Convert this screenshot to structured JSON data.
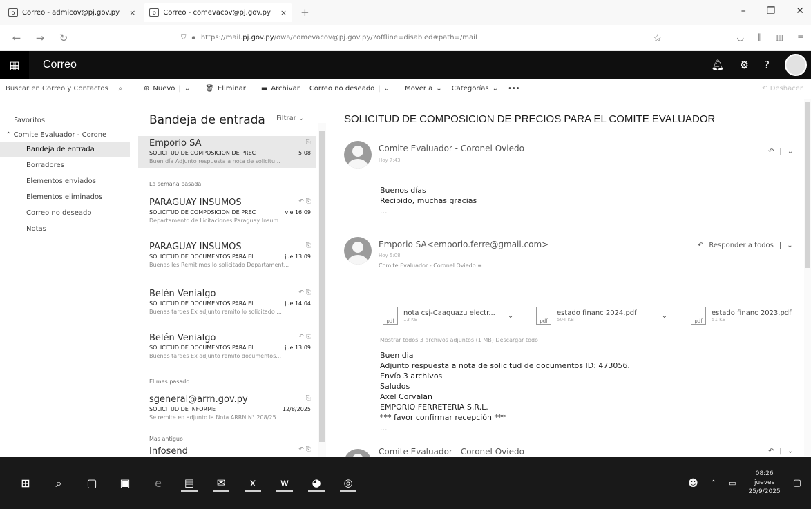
{
  "browser": {
    "tabs": [
      {
        "label": "Correo - admicov@pj.gov.py",
        "close": "×",
        "active": false
      },
      {
        "label": "Correo - comevacov@pj.gov.py",
        "close": "×",
        "active": true
      }
    ],
    "new_tab": "+",
    "url_prefix": "https://mail.",
    "url_domain": "pj.gov.py",
    "url_rest": "/owa/comevacov@pj.gov.py/?offline=disabled#path=/mail",
    "window_controls": [
      "–",
      "❐",
      "✕"
    ]
  },
  "owa": {
    "app_name": "Correo"
  },
  "commands": {
    "search_placeholder": "Buscar en Correo y Contactos",
    "nuevo": "Nuevo",
    "eliminar": "Eliminar",
    "archivar": "Archivar",
    "no_deseado": "Correo no deseado",
    "mover": "Mover a",
    "categorias": "Categorías",
    "mas": "•••",
    "deshacer": "Deshacer"
  },
  "folders": {
    "favorites": "Favoritos",
    "account": "Comite Evaluador - Corone",
    "items": [
      {
        "label": "Bandeja de entrada",
        "selected": true
      },
      {
        "label": "Borradores"
      },
      {
        "label": "Elementos enviados"
      },
      {
        "label": "Elementos eliminados"
      },
      {
        "label": "Correo no deseado"
      },
      {
        "label": "Notas"
      }
    ]
  },
  "list": {
    "title": "Bandeja de entrada",
    "filter": "Filtrar",
    "groups": [
      "La semana pasada",
      "El mes pasado",
      "Mas antiguo"
    ],
    "messages": [
      {
        "sender": "Emporio SA",
        "subject": "SOLICITUD DE COMPOSICION DE PREC",
        "time": "5:08",
        "preview": "Buen día Adjunto respuesta a nota de solicitu..."
      },
      {
        "sender": "PARAGUAY INSUMOS",
        "subject": "SOLICITUD DE COMPOSICION DE PREC",
        "time": "vie 16:09",
        "preview": "Departamento de Licitaciones Paraguay Insum..."
      },
      {
        "sender": "PARAGUAY INSUMOS",
        "subject": "SOLICITUD DE DOCUMENTOS PARA EL",
        "time": "jue 13:09",
        "preview": "Buenas les Remitimos lo solicitado Departament..."
      },
      {
        "sender": "Belén Venialgo",
        "subject": "SOLICITUD DE DOCUMENTOS PARA EL",
        "time": "jue 14:04",
        "preview": "Buenas tardes Ex adjunto remito lo solicitado ..."
      },
      {
        "sender": "Belén Venialgo",
        "subject": "SOLICITUD DE DOCUMENTOS PARA EL",
        "time": "jue 13:09",
        "preview": "Buenos tardes Ex adjunto remito documentos..."
      },
      {
        "sender": "sgeneral@arrn.gov.py",
        "subject": "SOLICITUD DE INFORME",
        "time": "12/8/2025",
        "preview": "Se remite en adjunto la Nota ARRN N° 208/25..."
      },
      {
        "sender": "Infosend",
        "subject": "",
        "time": "",
        "preview": ""
      }
    ]
  },
  "reading": {
    "subject": "SOLICITUD DE COMPOSICION DE PRECIOS PARA EL COMITE EVALUADOR",
    "msg1": {
      "from": "Comite Evaluador - Coronel Oviedo",
      "time": "Hoy 7:43",
      "lines": [
        "Buenos días",
        "Recibido, muchas gracias",
        "..."
      ]
    },
    "msg2": {
      "from": "Emporio SA<emporio.ferre@gmail.com>",
      "time": "Hoy 5:08",
      "to": "Comite Evaluador - Coronel Oviedo ≡",
      "reply_all": "Responder a todos",
      "attachments": [
        {
          "name": "nota csj-Caaguazu electr...",
          "size": "13 KB"
        },
        {
          "name": "estado financ 2024.pdf",
          "size": "504 KB"
        },
        {
          "name": "estado financ 2023.pdf",
          "size": "51 KB"
        }
      ],
      "show_all": "Mostrar todos 3 archivos adjuntos (1 MB)   Descargar todo",
      "lines": [
        "Buen dia",
        "Adjunto respuesta a nota de solicitud de documentos ID: 473056.",
        "Envío 3 archivos",
        "Saludos",
        "Axel Corvalan",
        "EMPORIO FERRETERIA S.R.L.",
        "*** favor confirmar recepción ***",
        "..."
      ]
    },
    "msg3": {
      "from": "Comite Evaluador - Coronel Oviedo"
    }
  },
  "taskbar": {
    "time": "08:26",
    "day": "jueves",
    "date": "25/9/2025"
  }
}
